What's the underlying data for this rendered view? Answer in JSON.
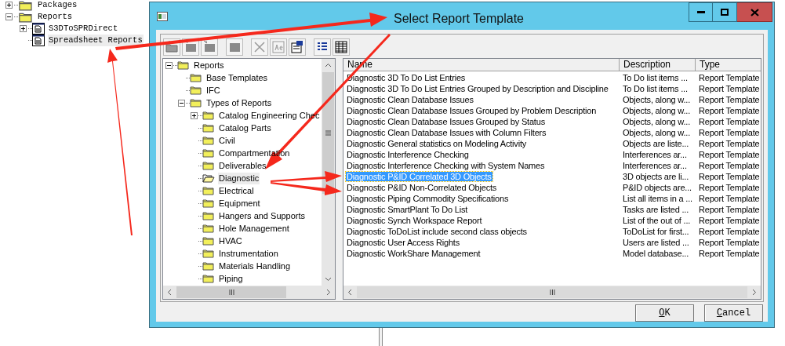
{
  "background_tree": [
    {
      "label": "Packages",
      "expanded": false,
      "selected": false,
      "kind": "folder"
    },
    {
      "label": "Reports",
      "expanded": true,
      "selected": false,
      "kind": "folder",
      "children": [
        {
          "label": "S3DToSPRDirect",
          "expanded": false,
          "selected": false,
          "kind": "report"
        },
        {
          "label": "Spreadsheet Reports",
          "selected": true,
          "kind": "report"
        }
      ]
    }
  ],
  "dialog": {
    "title": "Select Report Template",
    "folder_tree": [
      {
        "label": "Reports",
        "expanded": true,
        "selected": false,
        "children": [
          {
            "label": "Base Templates",
            "selected": false
          },
          {
            "label": "IFC",
            "selected": false
          },
          {
            "label": "Types of Reports",
            "expanded": true,
            "selected": false,
            "children": [
              {
                "label": "Catalog Engineering Chec",
                "expanded": false,
                "selected": false
              },
              {
                "label": "Catalog Parts",
                "selected": false
              },
              {
                "label": "Civil",
                "selected": false
              },
              {
                "label": "Compartmentation",
                "selected": false
              },
              {
                "label": "Deliverables",
                "selected": false
              },
              {
                "label": "Diagnostic",
                "selected": true
              },
              {
                "label": "Electrical",
                "selected": false
              },
              {
                "label": "Equipment",
                "selected": false
              },
              {
                "label": "Hangers and Supports",
                "selected": false
              },
              {
                "label": "Hole Management",
                "selected": false
              },
              {
                "label": "HVAC",
                "selected": false
              },
              {
                "label": "Instrumentation",
                "selected": false
              },
              {
                "label": "Materials Handling",
                "selected": false
              },
              {
                "label": "Piping",
                "selected": false
              }
            ]
          }
        ]
      }
    ],
    "table": {
      "columns": [
        "Name",
        "Description",
        "Type"
      ],
      "rows": [
        {
          "cells": [
            "Diagnostic 3D To Do List Entries",
            "To Do list items ...",
            "Report Template"
          ],
          "selected": false
        },
        {
          "cells": [
            "Diagnostic 3D To Do List Entries Grouped by Description and Discipline",
            "To Do list items ...",
            "Report Template"
          ],
          "selected": false
        },
        {
          "cells": [
            "Diagnostic Clean Database Issues",
            "Objects, along w...",
            "Report Template"
          ],
          "selected": false
        },
        {
          "cells": [
            "Diagnostic Clean Database Issues Grouped by Problem Description",
            "Objects, along w...",
            "Report Template"
          ],
          "selected": false
        },
        {
          "cells": [
            "Diagnostic Clean Database Issues Grouped by Status",
            "Objects, along w...",
            "Report Template"
          ],
          "selected": false
        },
        {
          "cells": [
            "Diagnostic Clean Database Issues with Column Filters",
            "Objects, along w...",
            "Report Template"
          ],
          "selected": false
        },
        {
          "cells": [
            "Diagnostic General statistics on Modeling Activity",
            "Objects are liste...",
            "Report Template"
          ],
          "selected": false
        },
        {
          "cells": [
            "Diagnostic Interference Checking",
            "Interferences ar...",
            "Report Template"
          ],
          "selected": false
        },
        {
          "cells": [
            "Diagnostic Interference Checking with System Names",
            "Interferences ar...",
            "Report Template"
          ],
          "selected": false
        },
        {
          "cells": [
            "Diagnostic P&ID Correlated 3D Objects",
            "3D objects are li...",
            "Report Template"
          ],
          "selected": true
        },
        {
          "cells": [
            "Diagnostic P&ID Non-Correlated Objects",
            "P&ID objects are...",
            "Report Template"
          ],
          "selected": false
        },
        {
          "cells": [
            "Diagnostic Piping Commodity Specifications",
            "List all items in a ...",
            "Report Template"
          ],
          "selected": false
        },
        {
          "cells": [
            "Diagnostic SmartPlant To Do List",
            "Tasks are listed ...",
            "Report Template"
          ],
          "selected": false
        },
        {
          "cells": [
            "Diagnostic Synch Workspace Report",
            "List of the out of ...",
            "Report Template"
          ],
          "selected": false
        },
        {
          "cells": [
            "Diagnostic ToDoList include second class objects",
            "ToDoList for first...",
            "Report Template"
          ],
          "selected": false
        },
        {
          "cells": [
            "Diagnostic User Access Rights",
            "Users are listed ...",
            "Report Template"
          ],
          "selected": false
        },
        {
          "cells": [
            "Diagnostic WorkShare Management",
            "Model database...",
            "Report Template"
          ],
          "selected": false
        }
      ]
    },
    "buttons": [
      "OK",
      "Cancel"
    ]
  }
}
